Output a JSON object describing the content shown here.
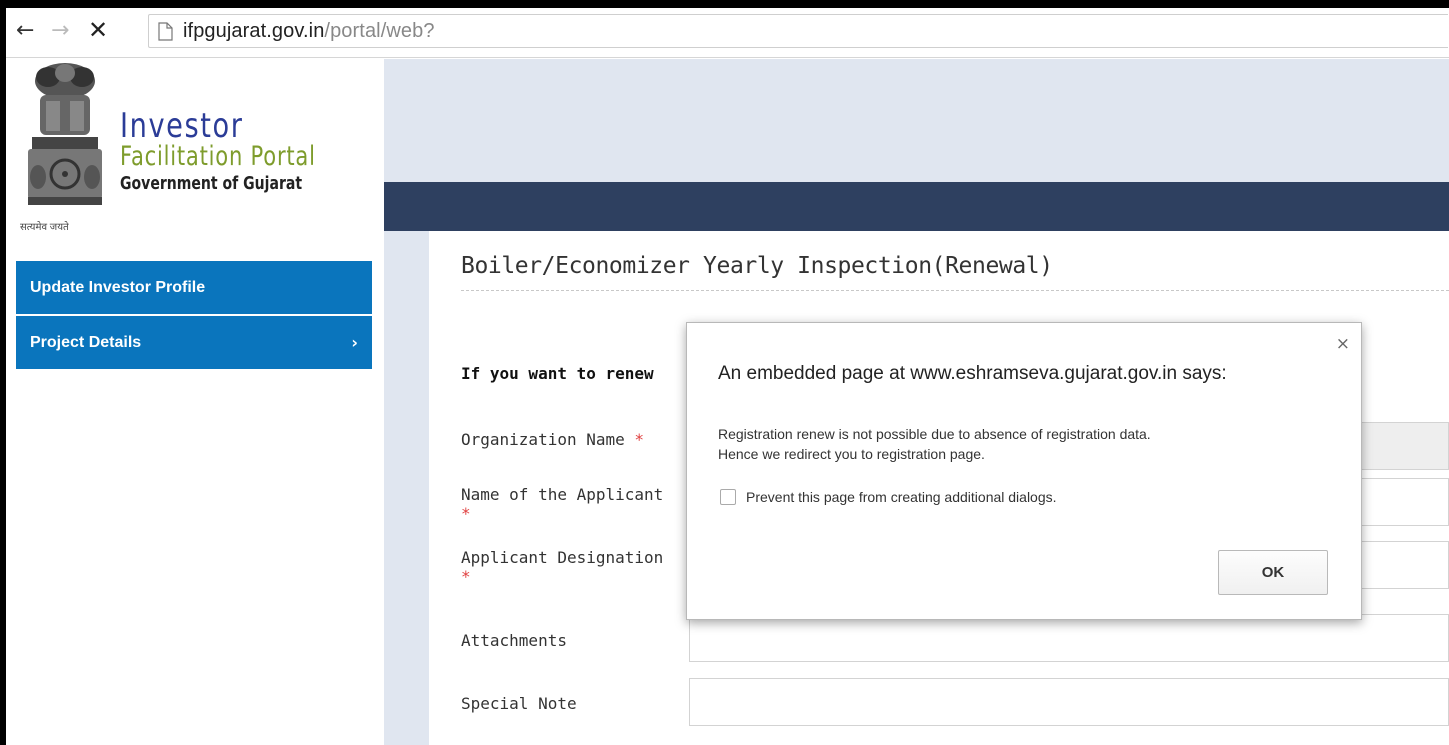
{
  "browser": {
    "url_host": "ifpgujarat.gov.in",
    "url_path": "/portal/web?"
  },
  "logo": {
    "line1": "Investor",
    "line2": "Facilitation Portal",
    "line3": "Government of Gujarat",
    "motto": "सत्यमेव जयते"
  },
  "sidebar": {
    "items": [
      {
        "label": "Update Investor Profile"
      },
      {
        "label": "Project Details",
        "chevron": "›"
      }
    ]
  },
  "page": {
    "title": "Boiler/Economizer Yearly Inspection(Renewal)",
    "renew_question": "If you want to renew",
    "required_mark": "*",
    "fields": [
      {
        "label": "Organization Name"
      },
      {
        "label": "Name of the Applicant"
      },
      {
        "label": "Applicant Designation"
      },
      {
        "label": "Attachments"
      },
      {
        "label": "Special Note"
      }
    ]
  },
  "dialog": {
    "title": "An embedded page at www.eshramseva.gujarat.gov.in says:",
    "message_line1": "Registration renew is not possible due to absence of registration data.",
    "message_line2": "Hence we redirect you to registration page.",
    "checkbox_label": "Prevent this page from creating additional dialogs.",
    "ok_label": "OK",
    "close_glyph": "×"
  },
  "colors": {
    "sidebar_blue": "#0a75bd",
    "header_navy": "#2e4060",
    "header_light": "#e0e6f0",
    "logo_blue": "#2b3c97",
    "logo_green": "#7e9c2c",
    "required_red": "#e04040"
  }
}
